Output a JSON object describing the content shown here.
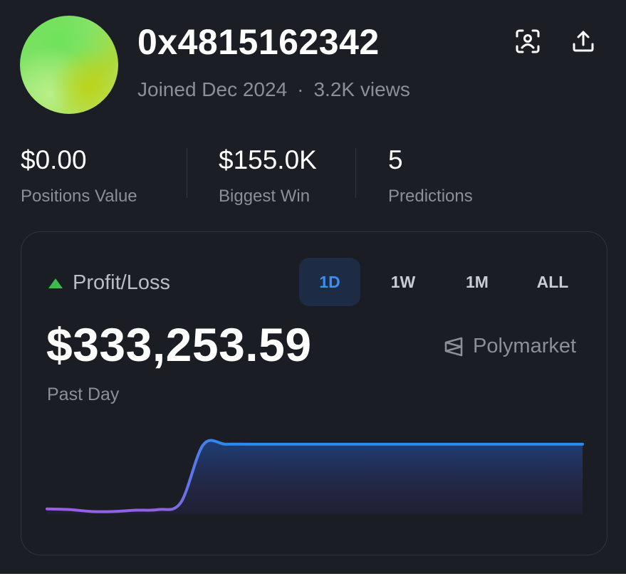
{
  "profile": {
    "username": "0x4815162342",
    "joined": "Joined Dec 2024",
    "separator": "·",
    "views": "3.2K views"
  },
  "header_icons": {
    "scan": "face-scan-icon",
    "share": "share-upload-icon"
  },
  "stats": [
    {
      "value": "$0.00",
      "label": "Positions Value"
    },
    {
      "value": "$155.0K",
      "label": "Biggest Win"
    },
    {
      "value": "5",
      "label": "Predictions"
    }
  ],
  "pnl_card": {
    "title": "Profit/Loss",
    "indicator_color": "#3fb950",
    "tabs": [
      "1D",
      "1W",
      "1M",
      "ALL"
    ],
    "active_tab": "1D",
    "value": "$333,253.59",
    "brand": "Polymarket",
    "period": "Past Day"
  },
  "colors": {
    "background": "#1b1e24",
    "accent_blue": "#3b8ef5",
    "line_start_purple": "#9b5de5",
    "line_end_blue": "#2b8af0"
  },
  "chart_data": {
    "type": "area",
    "title": "",
    "xlabel": "",
    "ylabel": "",
    "x": [
      0,
      1,
      2,
      3,
      4,
      5,
      6,
      7,
      8,
      9,
      10,
      11,
      12,
      13,
      14,
      15,
      16,
      17,
      18,
      19,
      20,
      21,
      22,
      23,
      24
    ],
    "series": [
      {
        "values": [
          -2,
          -3,
          -6,
          -6,
          -4,
          -3,
          8,
          97,
          98,
          98,
          98,
          98,
          98,
          98,
          98,
          98,
          98,
          98,
          98,
          98,
          98,
          98,
          98,
          98,
          98
        ]
      }
    ],
    "ylim": [
      -10,
      100
    ],
    "grid": false,
    "legend": "none"
  }
}
